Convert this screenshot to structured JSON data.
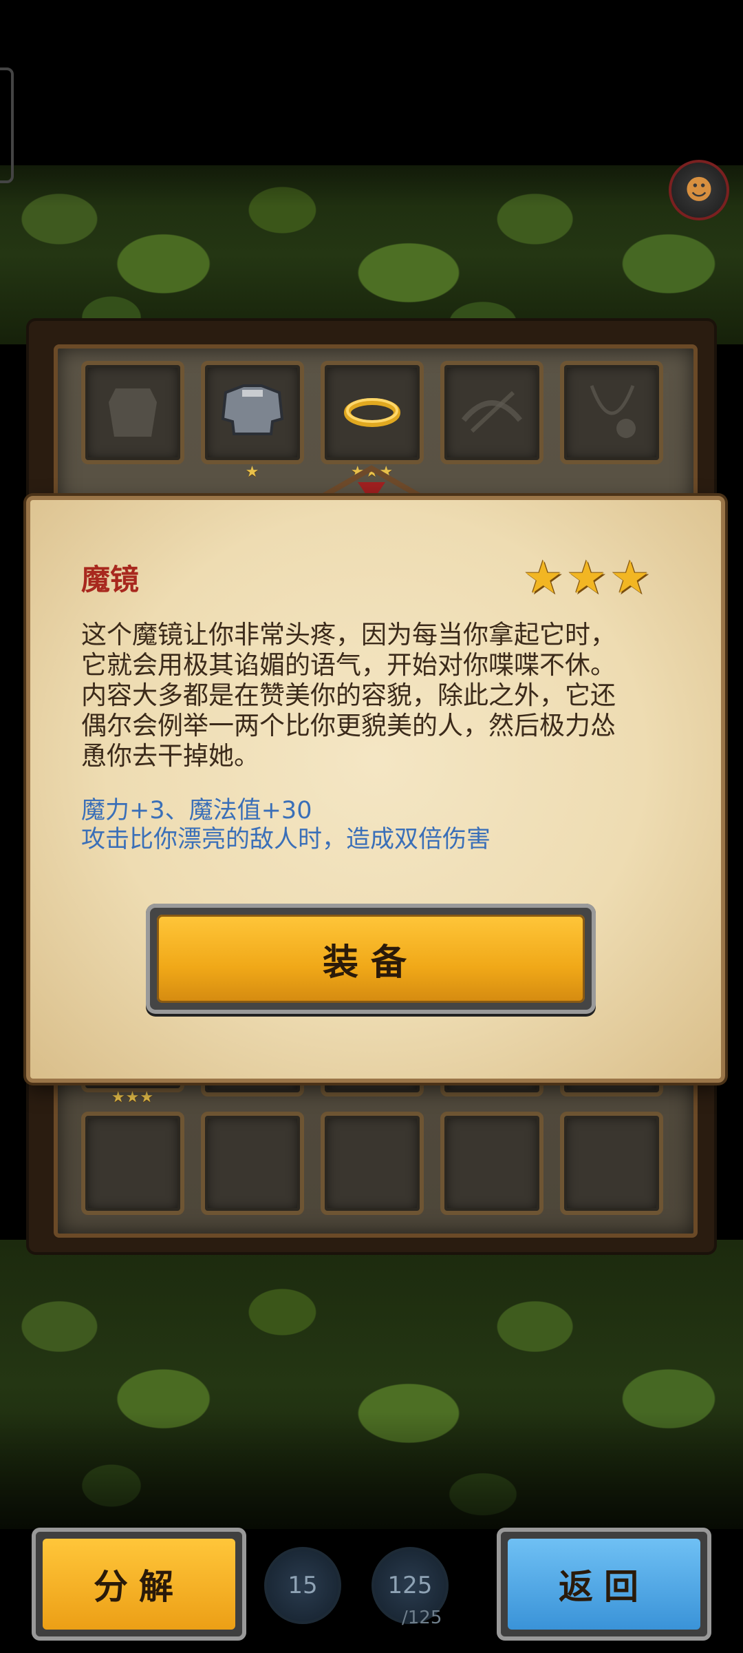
{
  "item": {
    "name": "魔镜",
    "stars": [
      "★",
      "★",
      "★"
    ],
    "description": "这个魔镜让你非常头疼，因为每当你拿起它时，它就会用极其谄媚的语气，开始对你喋喋不休。内容大多都是在赞美你的容貌，除此之外，它还偶尔会例举一两个比你更貌美的人，然后极力怂恿你去干掉她。",
    "effects": [
      "魔力+3、魔法值+30",
      "攻击比你漂亮的敌人时，造成双倍伤害"
    ]
  },
  "buttons": {
    "equip": "装备",
    "decompose": "分解",
    "back": "返回"
  },
  "counters": {
    "first": "15",
    "second": "125",
    "second_max": "/125"
  },
  "inventory": {
    "row1": [
      {
        "icon": "faded-armor-icon",
        "stars": ""
      },
      {
        "icon": "iron-armor-icon",
        "stars": "★"
      },
      {
        "icon": "gold-ring-icon",
        "stars": "★★★"
      },
      {
        "icon": "faded-crossbow-icon",
        "stars": ""
      },
      {
        "icon": "faded-amulet-icon",
        "stars": ""
      }
    ],
    "row_partial_stars": "★★★"
  },
  "colors": {
    "title": "#a8281e",
    "effects": "#3a6fb8",
    "star": "#f2b623",
    "equip_button": "#f0a818",
    "back_button": "#3a93d8"
  }
}
